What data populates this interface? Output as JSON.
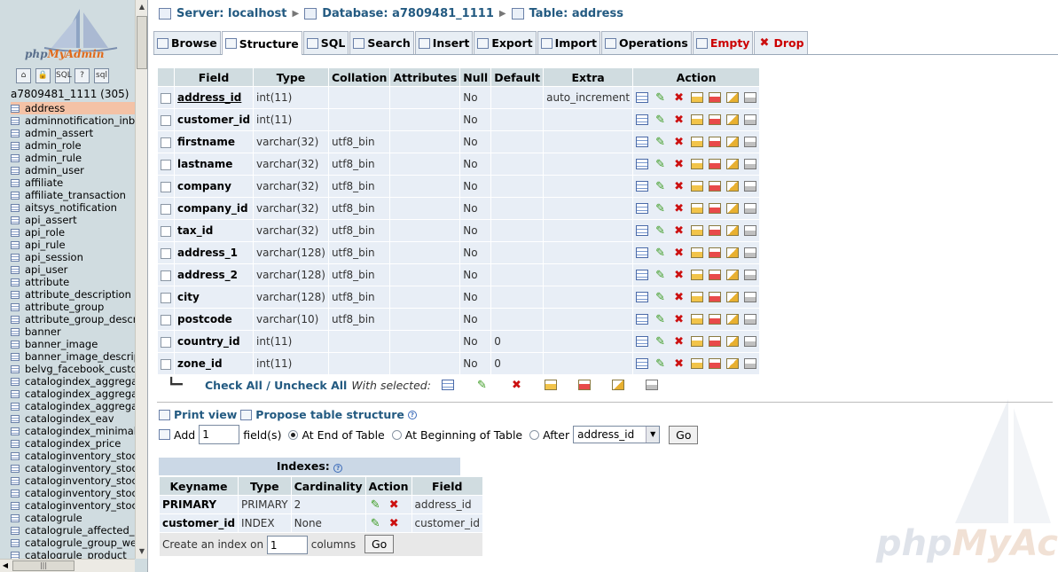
{
  "nav": {
    "logo_pre": "php",
    "logo_post": "MyAdmin",
    "icons": [
      "home-icon",
      "lock-icon",
      "sql-icon",
      "help-icon",
      "query-icon"
    ],
    "icon_glyphs": [
      "⌂",
      "🔒",
      "SQL",
      "?",
      "sql"
    ],
    "database": "a7809481_1111 (305)",
    "tables": [
      "address",
      "adminnotification_inbo",
      "admin_assert",
      "admin_role",
      "admin_rule",
      "admin_user",
      "affiliate",
      "affiliate_transaction",
      "aitsys_notification",
      "api_assert",
      "api_role",
      "api_rule",
      "api_session",
      "api_user",
      "attribute",
      "attribute_description",
      "attribute_group",
      "attribute_group_descr",
      "banner",
      "banner_image",
      "banner_image_descrip",
      "belvg_facebook_custo",
      "catalogindex_aggregat",
      "catalogindex_aggregat",
      "catalogindex_aggregat",
      "catalogindex_eav",
      "catalogindex_minimal_",
      "catalogindex_price",
      "cataloginventory_stocl",
      "cataloginventory_stocl",
      "cataloginventory_stocl",
      "cataloginventory_stocl",
      "cataloginventory_stocl",
      "catalogrule",
      "catalogrule_affected_p",
      "catalogrule_group_we",
      "catalogrule_product"
    ]
  },
  "breadcrumb": {
    "server": "Server: localhost",
    "database": "Database: a7809481_1111",
    "table": "Table: address"
  },
  "tabs": [
    {
      "label": "Browse",
      "icon": "browse-icon"
    },
    {
      "label": "Structure",
      "icon": "structure-icon"
    },
    {
      "label": "SQL",
      "icon": "sql-icon"
    },
    {
      "label": "Search",
      "icon": "search-icon"
    },
    {
      "label": "Insert",
      "icon": "insert-icon"
    },
    {
      "label": "Export",
      "icon": "export-icon"
    },
    {
      "label": "Import",
      "icon": "import-icon"
    },
    {
      "label": "Operations",
      "icon": "operations-icon"
    },
    {
      "label": "Empty",
      "icon": "empty-icon"
    },
    {
      "label": "Drop",
      "icon": "drop-icon"
    }
  ],
  "structure": {
    "headers": [
      "Field",
      "Type",
      "Collation",
      "Attributes",
      "Null",
      "Default",
      "Extra",
      "Action"
    ],
    "rows": [
      {
        "field": "address_id",
        "type": "int(11)",
        "collation": "",
        "attributes": "",
        "null": "No",
        "default": "",
        "extra": "auto_increment",
        "pk": true
      },
      {
        "field": "customer_id",
        "type": "int(11)",
        "collation": "",
        "attributes": "",
        "null": "No",
        "default": "",
        "extra": "",
        "pk": false
      },
      {
        "field": "firstname",
        "type": "varchar(32)",
        "collation": "utf8_bin",
        "attributes": "",
        "null": "No",
        "default": "",
        "extra": "",
        "pk": false
      },
      {
        "field": "lastname",
        "type": "varchar(32)",
        "collation": "utf8_bin",
        "attributes": "",
        "null": "No",
        "default": "",
        "extra": "",
        "pk": false
      },
      {
        "field": "company",
        "type": "varchar(32)",
        "collation": "utf8_bin",
        "attributes": "",
        "null": "No",
        "default": "",
        "extra": "",
        "pk": false
      },
      {
        "field": "company_id",
        "type": "varchar(32)",
        "collation": "utf8_bin",
        "attributes": "",
        "null": "No",
        "default": "",
        "extra": "",
        "pk": false
      },
      {
        "field": "tax_id",
        "type": "varchar(32)",
        "collation": "utf8_bin",
        "attributes": "",
        "null": "No",
        "default": "",
        "extra": "",
        "pk": false
      },
      {
        "field": "address_1",
        "type": "varchar(128)",
        "collation": "utf8_bin",
        "attributes": "",
        "null": "No",
        "default": "",
        "extra": "",
        "pk": false
      },
      {
        "field": "address_2",
        "type": "varchar(128)",
        "collation": "utf8_bin",
        "attributes": "",
        "null": "No",
        "default": "",
        "extra": "",
        "pk": false
      },
      {
        "field": "city",
        "type": "varchar(128)",
        "collation": "utf8_bin",
        "attributes": "",
        "null": "No",
        "default": "",
        "extra": "",
        "pk": false
      },
      {
        "field": "postcode",
        "type": "varchar(10)",
        "collation": "utf8_bin",
        "attributes": "",
        "null": "No",
        "default": "",
        "extra": "",
        "pk": false
      },
      {
        "field": "country_id",
        "type": "int(11)",
        "collation": "",
        "attributes": "",
        "null": "No",
        "default": "0",
        "extra": "",
        "pk": false
      },
      {
        "field": "zone_id",
        "type": "int(11)",
        "collation": "",
        "attributes": "",
        "null": "No",
        "default": "0",
        "extra": "",
        "pk": false
      }
    ],
    "action_icons": [
      "browse-icon",
      "edit-icon",
      "delete-icon",
      "primary-key-icon",
      "unique-icon",
      "index-icon",
      "fulltext-icon"
    ]
  },
  "check_all": {
    "check_all": "Check All",
    "separator": " / ",
    "uncheck_all": "Uncheck All",
    "with_selected": "With selected:"
  },
  "print_view": "Print view",
  "propose": "Propose table structure",
  "add_fields": {
    "add_label": "Add",
    "count": "1",
    "fields_label": "field(s)",
    "at_end": "At End of Table",
    "at_beginning": "At Beginning of Table",
    "after": "After",
    "after_value": "address_id",
    "go": "Go"
  },
  "indexes": {
    "title": "Indexes:",
    "headers": [
      "Keyname",
      "Type",
      "Cardinality",
      "Action",
      "Field"
    ],
    "rows": [
      {
        "keyname": "PRIMARY",
        "type": "PRIMARY",
        "cardinality": "2",
        "field": "address_id"
      },
      {
        "keyname": "customer_id",
        "type": "INDEX",
        "cardinality": "None",
        "field": "customer_id"
      }
    ],
    "create_label": "Create an index on",
    "create_count": "1",
    "columns_label": "columns",
    "go": "Go"
  },
  "watermark": {
    "pre": "php",
    "post": "MyAc"
  },
  "colors": {
    "link": "#235a81",
    "header_bg": "#d0dce0",
    "row_bg": "#e8eef6",
    "danger": "#cc0000",
    "nav_bg": "#d0dce0",
    "active_table": "#f4c2a6"
  }
}
